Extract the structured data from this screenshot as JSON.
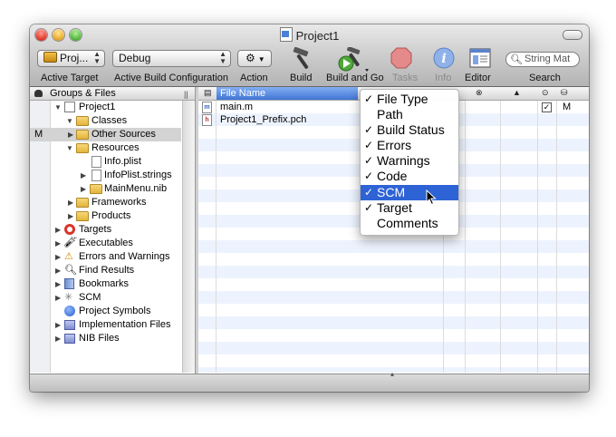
{
  "window": {
    "title": "Project1"
  },
  "toolbar": {
    "target_value": "Proj...",
    "target_label": "Active Target",
    "config_value": "Debug",
    "config_label": "Active Build Configuration",
    "action_label": "Action",
    "build_label": "Build",
    "build_and_go_label": "Build and Go",
    "tasks_label": "Tasks",
    "info_label": "Info",
    "editor_label": "Editor",
    "search_placeholder": "String Mat",
    "search_label": "Search"
  },
  "groups": {
    "header": "Groups & Files",
    "items": [
      {
        "label": "Project1",
        "scm": ""
      },
      {
        "label": "Classes",
        "scm": ""
      },
      {
        "label": "Other Sources",
        "scm": "M"
      },
      {
        "label": "Resources",
        "scm": ""
      },
      {
        "label": "Info.plist",
        "scm": ""
      },
      {
        "label": "InfoPlist.strings",
        "scm": ""
      },
      {
        "label": "MainMenu.nib",
        "scm": ""
      },
      {
        "label": "Frameworks",
        "scm": ""
      },
      {
        "label": "Products",
        "scm": ""
      },
      {
        "label": "Targets",
        "scm": ""
      },
      {
        "label": "Executables",
        "scm": ""
      },
      {
        "label": "Errors and Warnings",
        "scm": ""
      },
      {
        "label": "Find Results",
        "scm": ""
      },
      {
        "label": "Bookmarks",
        "scm": ""
      },
      {
        "label": "SCM",
        "scm": ""
      },
      {
        "label": "Project Symbols",
        "scm": ""
      },
      {
        "label": "Implementation Files",
        "scm": ""
      },
      {
        "label": "NIB Files",
        "scm": ""
      }
    ]
  },
  "detail": {
    "header": "File Name",
    "files": [
      {
        "name": "main.m",
        "icon_letter": "m",
        "scm": "M"
      },
      {
        "name": "Project1_Prefix.pch",
        "icon_letter": "h",
        "scm": ""
      }
    ]
  },
  "menu": {
    "items": [
      {
        "label": "File Type",
        "check": "✓"
      },
      {
        "label": "Path",
        "check": ""
      },
      {
        "label": "Build Status",
        "check": "✓"
      },
      {
        "label": "Errors",
        "check": "✓"
      },
      {
        "label": "Warnings",
        "check": "✓"
      },
      {
        "label": "Code",
        "check": "✓"
      },
      {
        "label": "SCM",
        "check": "✓"
      },
      {
        "label": "Target",
        "check": "✓"
      },
      {
        "label": "Comments",
        "check": ""
      }
    ]
  },
  "colors": {
    "selection": "#2e63d6",
    "header_selected": "#3f76d6",
    "row_stripe": "#edf3fe"
  }
}
